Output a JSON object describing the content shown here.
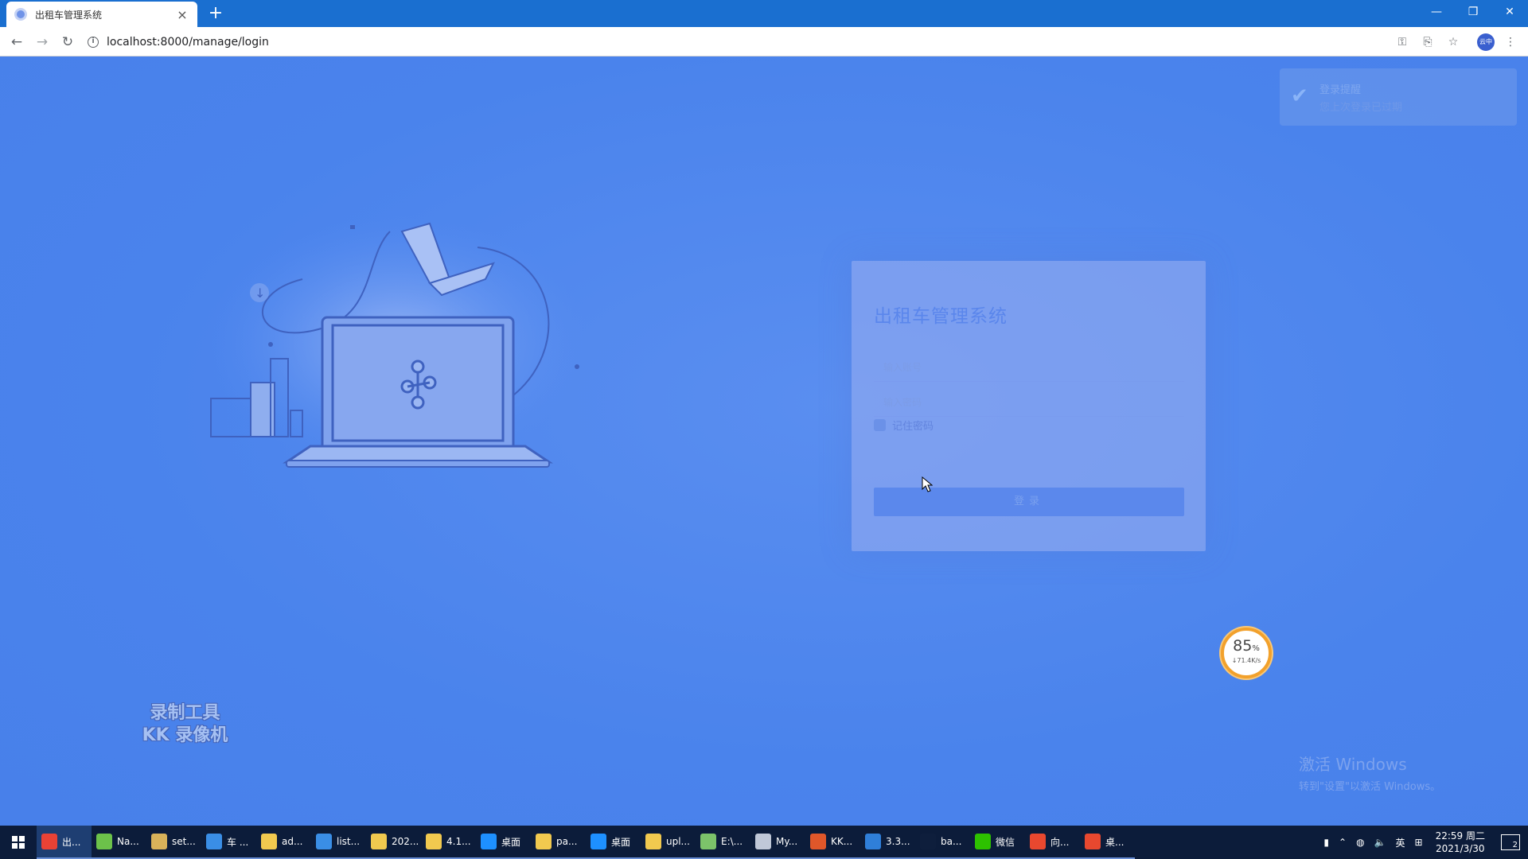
{
  "browser": {
    "tab_title": "出租车管理系统",
    "tab_close": "×",
    "new_tab": "+",
    "url": "localhost:8000/manage/login",
    "profile_label": "云中",
    "window_controls": [
      "—",
      "❐",
      "✕"
    ]
  },
  "toast": {
    "title": "登录提醒",
    "message": "您上次登录已过期"
  },
  "login": {
    "title": "出租车管理系统",
    "username_placeholder": "输入账号",
    "password_placeholder": "输入密码",
    "remember_label": "记住密码",
    "submit_label": "登录"
  },
  "netmeter": {
    "percent": "85",
    "percent_sign": "%",
    "speed": "↓71.4K/s"
  },
  "watermark": {
    "line1": "录制工具",
    "line2": "KK 录像机"
  },
  "activate_windows": {
    "title": "激活 Windows",
    "subtitle": "转到\"设置\"以激活 Windows。"
  },
  "taskbar": {
    "items": [
      {
        "label": "出...",
        "icon": "chrome-icon",
        "color": "#e94235",
        "active": true
      },
      {
        "label": "Na...",
        "icon": "navicat-icon",
        "color": "#6cc24a"
      },
      {
        "label": "set...",
        "icon": "folder-icon",
        "color": "#d8b25a"
      },
      {
        "label": "车 ...",
        "icon": "webstorm-icon",
        "color": "#3a8ee6"
      },
      {
        "label": "ad...",
        "icon": "file-icon",
        "color": "#f1c94f"
      },
      {
        "label": "list...",
        "icon": "webstorm-icon",
        "color": "#3a8ee6"
      },
      {
        "label": "202...",
        "icon": "file-icon",
        "color": "#f1c94f"
      },
      {
        "label": "4.1...",
        "icon": "file-icon",
        "color": "#f1c94f"
      },
      {
        "label": "桌面",
        "icon": "desktop-icon",
        "color": "#1e90ff"
      },
      {
        "label": "pa...",
        "icon": "file-icon",
        "color": "#f1c94f"
      },
      {
        "label": "桌面",
        "icon": "desktop-icon",
        "color": "#1e90ff"
      },
      {
        "label": "upl...",
        "icon": "file-icon",
        "color": "#f1c94f"
      },
      {
        "label": "E:\\...",
        "icon": "notepad-icon",
        "color": "#7cc36a"
      },
      {
        "label": "My...",
        "icon": "pen-icon",
        "color": "#c0c8d8"
      },
      {
        "label": "KK...",
        "icon": "kk-recorder-icon",
        "color": "#e0572a"
      },
      {
        "label": "3.3...",
        "icon": "vscode-icon",
        "color": "#2f7fd9"
      },
      {
        "label": "ba...",
        "icon": "photoshop-icon",
        "color": "#0e1e3c"
      },
      {
        "label": "微信",
        "icon": "wechat-icon",
        "color": "#2dc100"
      },
      {
        "label": "向...",
        "icon": "app-icon",
        "color": "#e8482f"
      },
      {
        "label": "桌...",
        "icon": "app-icon",
        "color": "#e8482f"
      }
    ],
    "ime": "英",
    "time": "22:59 周二",
    "date": "2021/3/30",
    "notif_count": "2"
  }
}
